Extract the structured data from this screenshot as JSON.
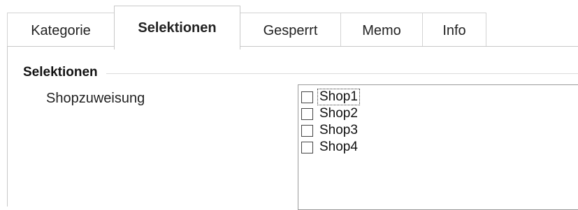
{
  "tabs": [
    {
      "label": "Kategorie",
      "active": false
    },
    {
      "label": "Selektionen",
      "active": true
    },
    {
      "label": "Gesperrt",
      "active": false
    },
    {
      "label": "Memo",
      "active": false
    },
    {
      "label": "Info",
      "active": false
    }
  ],
  "group": {
    "title": "Selektionen"
  },
  "field": {
    "label": "Shopzuweisung"
  },
  "list": {
    "items": [
      {
        "label": "Shop1",
        "checked": false
      },
      {
        "label": "Shop2",
        "checked": false
      },
      {
        "label": "Shop3",
        "checked": false
      },
      {
        "label": "Shop4",
        "checked": false
      }
    ]
  }
}
